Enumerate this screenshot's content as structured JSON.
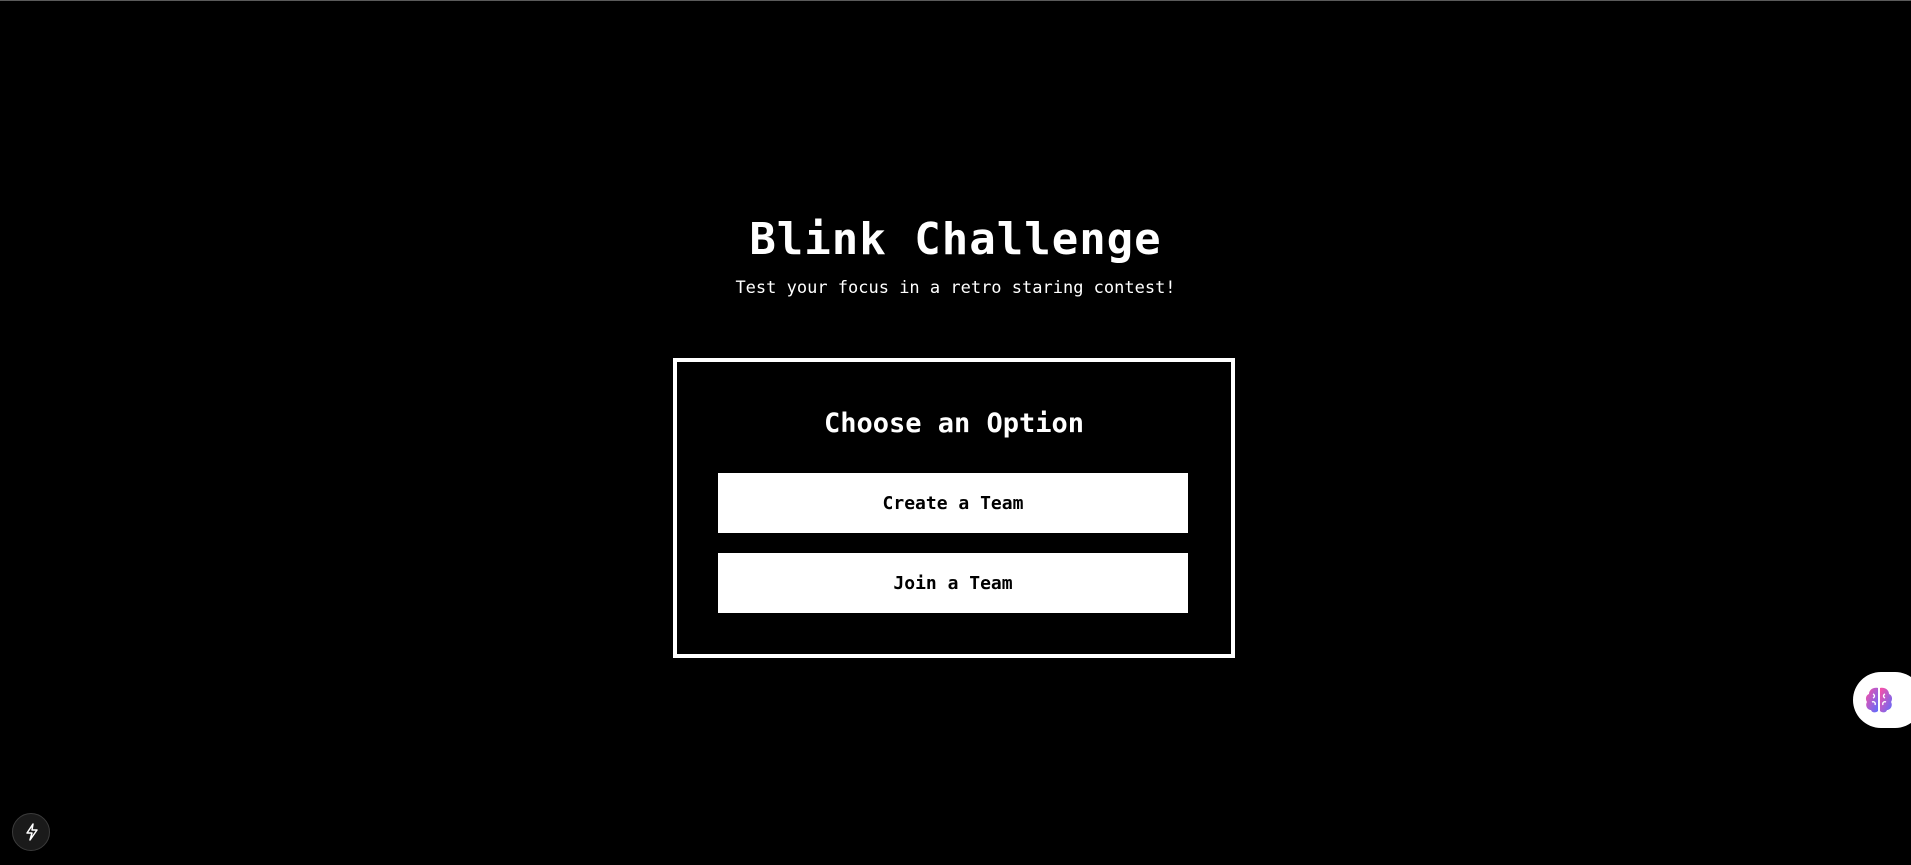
{
  "app": {
    "title": "Blink Challenge",
    "subtitle": "Test your focus in a retro staring contest!"
  },
  "card": {
    "title": "Choose an Option",
    "buttons": {
      "create_label": "Create a Team",
      "join_label": "Join a Team"
    }
  },
  "widgets": {
    "assistant_icon": "brain-icon",
    "dev_icon": "lightning-bolt-icon"
  },
  "colors": {
    "background": "#000000",
    "foreground": "#ffffff",
    "brain_gradient_start": "#ff4fa3",
    "brain_gradient_end": "#5b6cff"
  }
}
